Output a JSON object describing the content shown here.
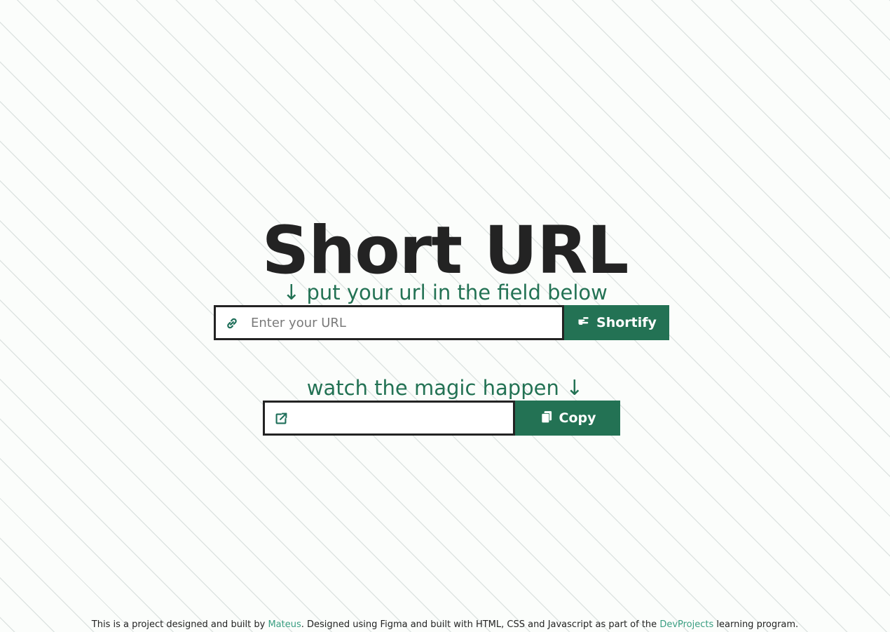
{
  "title": "Short URL",
  "input_section": {
    "arrow": "↓",
    "hint": "put your url in the field below",
    "link_icon": "link-icon",
    "placeholder": "Enter your URL",
    "value": "",
    "button_icon": "pointing-hand-icon",
    "button_label": "Shortify"
  },
  "output_section": {
    "hint": "watch the magic happen",
    "arrow": "↓",
    "external_icon": "external-link-icon",
    "value": "",
    "button_icon": "copy-icon",
    "button_label": "Copy"
  },
  "footer": {
    "text_before": "This is a project designed and built by ",
    "author_link": "Mateus",
    "text_middle": ". Designed using Figma and built with HTML, CSS and Javascript as part of the ",
    "program_link": "DevProjects",
    "text_after": " learning program."
  },
  "colors": {
    "accent": "#237254",
    "link": "#3a9e82",
    "text": "#232323",
    "background": "#fbfdfb"
  }
}
